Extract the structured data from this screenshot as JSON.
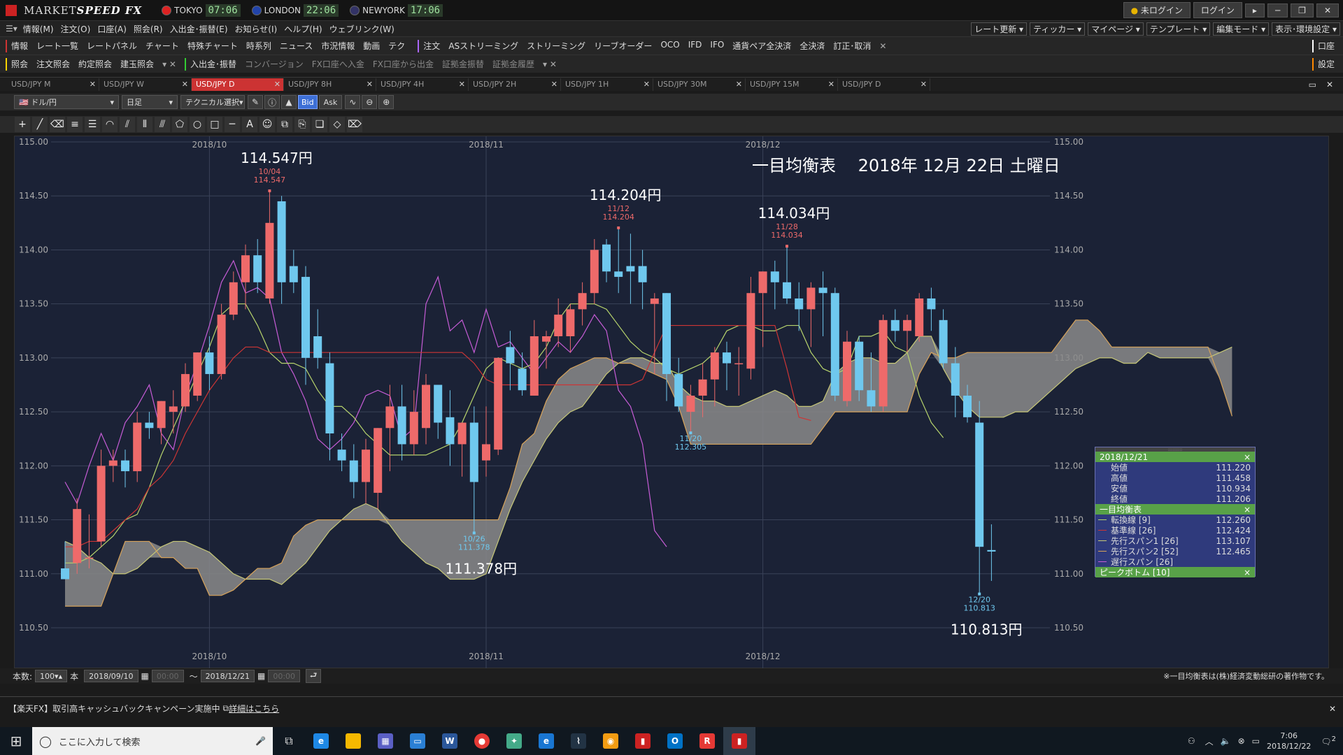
{
  "app": {
    "name_a": "MARKET",
    "name_b": "SPEED",
    "name_c": " FX"
  },
  "clocks": [
    {
      "city": "TOKYO",
      "time": "07:06",
      "color": "#d22"
    },
    {
      "city": "LONDON",
      "time": "22:06",
      "color": "#24a"
    },
    {
      "city": "NEWYORK",
      "time": "17:06",
      "color": "#336"
    }
  ],
  "title_buttons": {
    "login_status": "未ログイン",
    "login": "ログイン"
  },
  "menu": [
    "情報(M)",
    "注文(O)",
    "口座(A)",
    "照会(R)",
    "入出金･振替(E)",
    "お知らせ(I)",
    "ヘルプ(H)",
    "ウェブリンク(W)"
  ],
  "right_menu": [
    "レート更新",
    "ティッカー",
    "マイページ",
    "テンプレート",
    "編集モード",
    "表示･環境設定"
  ],
  "row1": {
    "info": "情報",
    "items": [
      "レート一覧",
      "レートパネル",
      "チャート",
      "特殊チャート",
      "時系列",
      "ニュース",
      "市況情報",
      "動画",
      "テク"
    ],
    "order": "注文",
    "order_items": [
      "ASストリーミング",
      "ストリーミング",
      "リーブオーダー",
      "OCO",
      "IFD",
      "IFO",
      "通貨ペア全決済",
      "全決済",
      "訂正･取消"
    ],
    "right": "口座"
  },
  "row2": {
    "inquiry": "照会",
    "items": [
      "注文照会",
      "約定照会",
      "建玉照会"
    ],
    "deposit": "入出金･振替",
    "transfer_items": [
      "コンバージョン",
      "FX口座へ入金",
      "FX口座から出金",
      "証拠金振替",
      "証拠金履歴"
    ],
    "right": "設定"
  },
  "tabs": [
    "USD/JPY M",
    "USD/JPY W",
    "USD/JPY D",
    "USD/JPY 8H",
    "USD/JPY 4H",
    "USD/JPY 2H",
    "USD/JPY 1H",
    "USD/JPY 30M",
    "USD/JPY 15M",
    "USD/JPY D"
  ],
  "active_tab": 2,
  "toolbar": {
    "pair": "ドル/円",
    "period": "日足",
    "technical": "テクニカル選択",
    "bid": "Bid",
    "ask": "Ask"
  },
  "chart_data": {
    "type": "candlestick",
    "title": "一目均衡表　 2018年 12月 22日 土曜日",
    "ylim": [
      110.5,
      115.0
    ],
    "yticks": [
      "115.00",
      "114.50",
      "114.00",
      "113.50",
      "113.00",
      "112.50",
      "112.00",
      "111.50",
      "111.00",
      "110.50"
    ],
    "xticks": [
      "2018/10",
      "2018/11",
      "2018/12"
    ],
    "candles": [
      {
        "o": 111.05,
        "h": 111.3,
        "l": 110.95,
        "c": 110.95
      },
      {
        "o": 111.1,
        "h": 111.7,
        "l": 111.0,
        "c": 111.6
      },
      {
        "o": 111.15,
        "h": 111.55,
        "l": 111.05,
        "c": 111.15
      },
      {
        "o": 111.3,
        "h": 112.15,
        "l": 111.25,
        "c": 112.0
      },
      {
        "o": 112.0,
        "h": 112.15,
        "l": 111.85,
        "c": 112.05
      },
      {
        "o": 112.05,
        "h": 112.15,
        "l": 111.8,
        "c": 111.95
      },
      {
        "o": 111.95,
        "h": 112.5,
        "l": 111.85,
        "c": 112.4
      },
      {
        "o": 112.4,
        "h": 112.5,
        "l": 112.25,
        "c": 112.35
      },
      {
        "o": 112.35,
        "h": 112.6,
        "l": 112.2,
        "c": 112.6
      },
      {
        "o": 112.5,
        "h": 112.7,
        "l": 112.3,
        "c": 112.55
      },
      {
        "o": 112.55,
        "h": 112.95,
        "l": 112.5,
        "c": 112.85
      },
      {
        "o": 112.65,
        "h": 113.05,
        "l": 112.6,
        "c": 113.05
      },
      {
        "o": 113.05,
        "h": 113.2,
        "l": 112.7,
        "c": 112.85
      },
      {
        "o": 112.85,
        "h": 113.5,
        "l": 112.8,
        "c": 113.4
      },
      {
        "o": 113.4,
        "h": 113.8,
        "l": 113.35,
        "c": 113.7
      },
      {
        "o": 113.7,
        "h": 114.05,
        "l": 113.45,
        "c": 113.95
      },
      {
        "o": 113.95,
        "h": 114.1,
        "l": 113.6,
        "c": 113.7
      },
      {
        "o": 113.55,
        "h": 114.547,
        "l": 113.5,
        "c": 114.25
      },
      {
        "o": 114.45,
        "h": 114.5,
        "l": 113.5,
        "c": 113.7
      },
      {
        "o": 113.85,
        "h": 114.0,
        "l": 113.6,
        "c": 113.7
      },
      {
        "o": 113.75,
        "h": 113.85,
        "l": 112.75,
        "c": 113.0
      },
      {
        "o": 113.2,
        "h": 113.45,
        "l": 112.9,
        "c": 113.0
      },
      {
        "o": 112.95,
        "h": 113.05,
        "l": 112.05,
        "c": 112.3
      },
      {
        "o": 112.15,
        "h": 112.3,
        "l": 111.95,
        "c": 112.05
      },
      {
        "o": 112.05,
        "h": 112.2,
        "l": 111.7,
        "c": 111.85
      },
      {
        "o": 111.85,
        "h": 112.25,
        "l": 111.65,
        "c": 112.15
      },
      {
        "o": 111.75,
        "h": 112.35,
        "l": 111.6,
        "c": 112.35
      },
      {
        "o": 112.35,
        "h": 112.75,
        "l": 111.95,
        "c": 112.55
      },
      {
        "o": 112.55,
        "h": 112.75,
        "l": 112.05,
        "c": 112.2
      },
      {
        "o": 112.2,
        "h": 112.7,
        "l": 112.1,
        "c": 112.5
      },
      {
        "o": 112.35,
        "h": 112.85,
        "l": 112.2,
        "c": 112.75
      },
      {
        "o": 112.75,
        "h": 112.75,
        "l": 112.25,
        "c": 112.4
      },
      {
        "o": 112.45,
        "h": 112.7,
        "l": 112.0,
        "c": 112.2
      },
      {
        "o": 112.2,
        "h": 112.4,
        "l": 111.9,
        "c": 112.4
      },
      {
        "o": 112.4,
        "h": 112.55,
        "l": 111.378,
        "c": 111.85
      },
      {
        "o": 112.05,
        "h": 112.55,
        "l": 111.9,
        "c": 112.2
      },
      {
        "o": 112.15,
        "h": 113.0,
        "l": 112.1,
        "c": 113.0
      },
      {
        "o": 113.1,
        "h": 113.25,
        "l": 112.7,
        "c": 112.95
      },
      {
        "o": 112.9,
        "h": 113.05,
        "l": 112.65,
        "c": 112.7
      },
      {
        "o": 112.65,
        "h": 113.35,
        "l": 112.65,
        "c": 113.2
      },
      {
        "o": 113.15,
        "h": 113.25,
        "l": 112.9,
        "c": 113.2
      },
      {
        "o": 113.2,
        "h": 113.55,
        "l": 113.1,
        "c": 113.4
      },
      {
        "o": 113.2,
        "h": 113.5,
        "l": 113.05,
        "c": 113.45
      },
      {
        "o": 113.45,
        "h": 113.7,
        "l": 113.3,
        "c": 113.6
      },
      {
        "o": 113.6,
        "h": 114.1,
        "l": 113.5,
        "c": 114.0
      },
      {
        "o": 114.05,
        "h": 114.1,
        "l": 113.7,
        "c": 113.8
      },
      {
        "o": 113.8,
        "h": 114.204,
        "l": 113.6,
        "c": 113.75
      },
      {
        "o": 113.85,
        "h": 114.15,
        "l": 113.5,
        "c": 113.8
      },
      {
        "o": 113.85,
        "h": 114.0,
        "l": 113.45,
        "c": 113.7
      },
      {
        "o": 113.5,
        "h": 113.6,
        "l": 112.85,
        "c": 113.55
      },
      {
        "o": 113.6,
        "h": 113.6,
        "l": 112.6,
        "c": 112.85
      },
      {
        "o": 112.85,
        "h": 113.0,
        "l": 112.5,
        "c": 112.55
      },
      {
        "o": 112.5,
        "h": 112.75,
        "l": 112.305,
        "c": 112.65
      },
      {
        "o": 112.65,
        "h": 112.95,
        "l": 112.45,
        "c": 112.8
      },
      {
        "o": 112.8,
        "h": 113.1,
        "l": 112.55,
        "c": 113.05
      },
      {
        "o": 113.05,
        "h": 113.15,
        "l": 112.7,
        "c": 112.95
      },
      {
        "o": 112.95,
        "h": 113.1,
        "l": 112.65,
        "c": 112.95
      },
      {
        "o": 112.9,
        "h": 113.75,
        "l": 112.8,
        "c": 113.6
      },
      {
        "o": 113.6,
        "h": 113.8,
        "l": 113.1,
        "c": 113.8
      },
      {
        "o": 113.8,
        "h": 113.9,
        "l": 113.45,
        "c": 113.7
      },
      {
        "o": 113.7,
        "h": 114.034,
        "l": 113.5,
        "c": 113.55
      },
      {
        "o": 113.55,
        "h": 113.7,
        "l": 113.25,
        "c": 113.45
      },
      {
        "o": 113.45,
        "h": 113.7,
        "l": 113.1,
        "c": 113.65
      },
      {
        "o": 113.65,
        "h": 113.8,
        "l": 113.2,
        "c": 113.6
      },
      {
        "o": 113.6,
        "h": 113.65,
        "l": 112.6,
        "c": 112.65
      },
      {
        "o": 112.6,
        "h": 113.25,
        "l": 112.55,
        "c": 113.15
      },
      {
        "o": 113.15,
        "h": 113.2,
        "l": 112.6,
        "c": 112.7
      },
      {
        "o": 112.7,
        "h": 113.05,
        "l": 112.5,
        "c": 112.55
      },
      {
        "o": 112.55,
        "h": 113.4,
        "l": 112.5,
        "c": 113.35
      },
      {
        "o": 113.35,
        "h": 113.45,
        "l": 113.15,
        "c": 113.25
      },
      {
        "o": 113.25,
        "h": 113.4,
        "l": 113.05,
        "c": 113.35
      },
      {
        "o": 113.2,
        "h": 113.6,
        "l": 113.15,
        "c": 113.55
      },
      {
        "o": 113.55,
        "h": 113.65,
        "l": 113.25,
        "c": 113.45
      },
      {
        "o": 113.35,
        "h": 113.45,
        "l": 112.9,
        "c": 112.95
      },
      {
        "o": 112.95,
        "h": 113.1,
        "l": 112.45,
        "c": 112.65
      },
      {
        "o": 112.65,
        "h": 112.75,
        "l": 112.4,
        "c": 112.45
      },
      {
        "o": 112.4,
        "h": 112.6,
        "l": 110.813,
        "c": 111.25
      },
      {
        "o": 111.22,
        "h": 111.458,
        "l": 110.934,
        "c": 111.206
      }
    ],
    "tenkan": [
      111.1,
      111.1,
      111.15,
      111.25,
      111.35,
      111.5,
      111.55,
      111.8,
      112.1,
      112.35,
      112.6,
      112.85,
      113.1,
      113.4,
      113.5,
      113.5,
      113.3,
      113.05,
      112.95,
      112.95,
      112.9,
      112.7,
      112.55,
      112.55,
      112.45,
      112.3,
      112.2,
      112.1,
      112.1,
      112.1,
      112.1,
      112.15,
      112.2,
      112.4,
      112.65,
      112.9,
      113.0,
      112.95,
      112.9,
      112.95,
      113.1,
      113.35,
      113.5,
      113.5,
      113.5,
      113.45,
      113.3,
      113.15,
      113.05,
      113.0,
      112.9,
      112.85,
      112.9,
      112.95,
      113.05,
      113.25,
      113.3,
      113.3,
      113.25,
      113.25,
      113.3,
      113.3,
      113.05,
      112.9,
      112.85,
      112.9,
      113.2,
      113.2,
      113.25,
      113.1,
      113.05,
      112.65,
      112.4,
      112.26
    ],
    "kijun": [
      111.25,
      111.25,
      111.3,
      111.3,
      111.4,
      111.5,
      111.6,
      111.8,
      111.9,
      112.05,
      112.3,
      112.5,
      112.7,
      112.85,
      113.0,
      113.1,
      113.1,
      113.05,
      113.05,
      113.05,
      113.05,
      113.05,
      113.05,
      113.05,
      113.05,
      113.05,
      113.05,
      113.05,
      113.05,
      113.05,
      113.05,
      113.05,
      113.05,
      113.05,
      112.95,
      112.8,
      112.75,
      112.75,
      112.75,
      112.75,
      112.75,
      112.75,
      112.75,
      112.75,
      112.75,
      112.75,
      112.75,
      112.75,
      112.8,
      113.05,
      113.3,
      113.3,
      113.3,
      113.3,
      113.3,
      113.3,
      113.3,
      113.3,
      113.3,
      113.3,
      112.9,
      112.45,
      112.42
    ],
    "span1": [
      111.3,
      111.25,
      111.15,
      111.1,
      111.0,
      111.0,
      111.05,
      111.15,
      111.25,
      111.3,
      111.3,
      111.25,
      111.2,
      111.1,
      111.0,
      110.95,
      110.95,
      110.95,
      110.9,
      111.0,
      111.1,
      111.25,
      111.4,
      111.5,
      111.6,
      111.65,
      111.6,
      111.45,
      111.3,
      111.2,
      111.1,
      111.05,
      110.95,
      110.95,
      110.95,
      111.0,
      111.3,
      111.6,
      111.85,
      112.05,
      112.25,
      112.4,
      112.5,
      112.55,
      112.7,
      112.85,
      112.95,
      113.0,
      113.0,
      112.95,
      112.95,
      112.75,
      112.65,
      112.6,
      112.6,
      112.55,
      112.55,
      112.6,
      112.65,
      112.7,
      112.65,
      112.55,
      112.55,
      112.6,
      112.85,
      112.95,
      113.0,
      113.0,
      112.95,
      112.95,
      113.05,
      113.2,
      113.2,
      112.9,
      112.7,
      112.55,
      112.45,
      112.45,
      112.45,
      112.5,
      112.5,
      112.6,
      112.7,
      112.8,
      112.9,
      112.95,
      113.0,
      113.0,
      112.95,
      112.95,
      113.05,
      113.0,
      113.0,
      113.0,
      113.0,
      113.0,
      113.05,
      113.1
    ],
    "span2": [
      110.7,
      110.7,
      110.7,
      110.7,
      111.0,
      111.3,
      111.3,
      111.3,
      111.15,
      111.15,
      111.05,
      111.05,
      110.8,
      110.8,
      110.85,
      110.95,
      111.05,
      111.05,
      111.1,
      111.35,
      111.45,
      111.5,
      111.5,
      111.5,
      111.5,
      111.5,
      111.5,
      111.5,
      111.5,
      111.5,
      111.5,
      111.5,
      111.5,
      111.5,
      111.5,
      111.5,
      111.5,
      111.8,
      112.2,
      112.3,
      112.6,
      112.8,
      112.9,
      112.95,
      113.0,
      113.0,
      112.95,
      112.95,
      112.9,
      112.85,
      112.8,
      112.55,
      112.2,
      112.2,
      112.2,
      112.2,
      112.2,
      112.2,
      112.2,
      112.2,
      112.2,
      112.2,
      112.2,
      112.35,
      112.5,
      112.5,
      112.5,
      112.5,
      112.5,
      112.5,
      112.5,
      112.85,
      113.05,
      113.0,
      113.0,
      113.05,
      113.05,
      113.05,
      113.05,
      113.05,
      113.05,
      113.05,
      113.05,
      113.2,
      113.35,
      113.35,
      113.25,
      113.1,
      113.1,
      113.1,
      113.1,
      113.1,
      113.1,
      113.1,
      113.1,
      113.1,
      112.8,
      112.46
    ],
    "chikou": [
      111.85,
      111.65,
      112.0,
      112.3,
      112.05,
      112.4,
      112.55,
      112.75,
      112.3,
      112.15,
      112.65,
      112.95,
      113.3,
      113.7,
      113.9,
      113.6,
      113.65,
      113.55,
      113.05,
      112.85,
      112.6,
      112.25,
      112.15,
      112.25,
      112.4,
      112.65,
      112.7,
      112.65,
      112.25,
      112.35,
      113.5,
      113.75,
      113.25,
      113.35,
      113.05,
      113.45,
      113.1,
      113.15,
      113.0,
      112.85,
      113.0,
      113.15,
      113.05,
      113.2,
      113.4,
      113.25,
      112.7,
      112.55,
      112.2,
      111.4,
      111.25
    ],
    "peaks": [
      {
        "i": 17,
        "date": "10/04",
        "price": "114.547",
        "big": "114.547円",
        "dir": "up"
      },
      {
        "i": 46,
        "date": "11/12",
        "price": "114.204",
        "big": "114.204円",
        "dir": "up"
      },
      {
        "i": 60,
        "date": "11/28",
        "price": "114.034",
        "big": "114.034円",
        "dir": "up"
      },
      {
        "i": 34,
        "date": "10/26",
        "price": "111.378",
        "big": "111.378円",
        "dir": "down"
      },
      {
        "i": 52,
        "date": "11/20",
        "price": "112.305",
        "big": "",
        "dir": "down"
      },
      {
        "i": 76,
        "date": "12/20",
        "price": "110.813",
        "big": "110.813円",
        "dir": "down"
      }
    ],
    "colors": {
      "up": "#ee6a6a",
      "down": "#6fc8ee",
      "tenkan": "#b6d36c",
      "kijun": "#cc3535",
      "span1": "#c7c878",
      "span2": "#d7a35a",
      "chikou": "#c65cd6",
      "cloud": "#8a8a8a"
    }
  },
  "info_panel": {
    "date": "2018/12/21",
    "ohlc": [
      {
        "label": "始値",
        "value": "111.220"
      },
      {
        "label": "高値",
        "value": "111.458"
      },
      {
        "label": "安値",
        "value": "110.934"
      },
      {
        "label": "終値",
        "value": "111.206"
      }
    ],
    "ichimoku_title": "一目均衡表",
    "ichimoku": [
      {
        "label": "転換線 [9]",
        "value": "112.260",
        "color": "#b6d36c"
      },
      {
        "label": "基準線 [26]",
        "value": "112.424",
        "color": "#cc3535"
      },
      {
        "label": "先行スパン1 [26]",
        "value": "113.107",
        "color": "#c7c878"
      },
      {
        "label": "先行スパン2 [52]",
        "value": "112.465",
        "color": "#d7a35a"
      },
      {
        "label": "遅行スパン [26]",
        "value": "",
        "color": "#c65cd6"
      }
    ],
    "peak_title": "ピークボトム [10]"
  },
  "footer": {
    "count_label": "本数:",
    "count": "100",
    "unit": "本",
    "from": "2018/09/10",
    "to": "2018/12/21",
    "time": "00:00",
    "tilde": "～",
    "copyright": "※一目均衡表は(株)経済変動総研の著作物です。"
  },
  "news": {
    "text": "【楽天FX】取引高キャッシュバックキャンペーン実施中",
    "link": "詳細はこちら"
  },
  "taskbar": {
    "search": "ここに入力して検索",
    "time": "7:06",
    "date": "2018/12/22",
    "badge": "2"
  }
}
